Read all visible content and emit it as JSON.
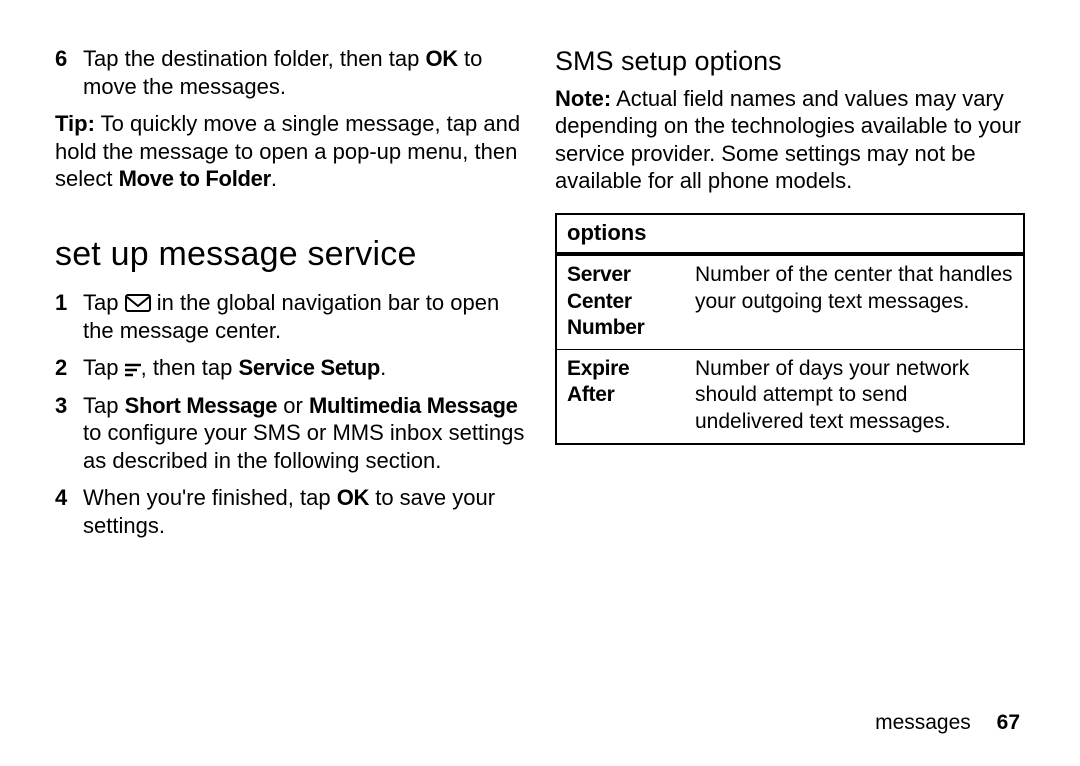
{
  "left": {
    "step6": {
      "num": "6",
      "pre": "Tap the destination folder, then tap ",
      "ok": "OK",
      "post": " to move the messages."
    },
    "tip": {
      "label": "Tip:",
      "body": " To quickly move a single message, tap and hold the message to open a pop-up menu, then select ",
      "bold": "Move to Folder",
      "end": "."
    },
    "heading": "set up message service",
    "steps": [
      {
        "num": "1",
        "pre": "Tap ",
        "post": " in the global navigation bar to open the message center."
      },
      {
        "num": "2",
        "pre": "Tap ",
        "mid": ", then tap ",
        "bold": "Service Setup",
        "end": "."
      },
      {
        "num": "3",
        "pre": "Tap ",
        "b1": "Short Message",
        "mid": " or ",
        "b2": "Multimedia Message",
        "post": " to configure your SMS or MMS inbox settings as described in the following section."
      },
      {
        "num": "4",
        "pre": "When you're finished, tap ",
        "ok": "OK",
        "post": " to save your settings."
      }
    ]
  },
  "right": {
    "heading": "SMS setup options",
    "note": {
      "label": "Note:",
      "body": " Actual field names and values may vary depending on the technologies available to your service provider. Some settings may not be available for all phone models."
    },
    "table": {
      "header": "options",
      "rows": [
        {
          "k": "Server Center Number",
          "v": "Number of the center that handles your outgoing text messages."
        },
        {
          "k": "Expire After",
          "v": "Number of days your network should attempt to send undelivered text messages."
        }
      ]
    }
  },
  "footer": {
    "section": "messages",
    "page": "67"
  }
}
